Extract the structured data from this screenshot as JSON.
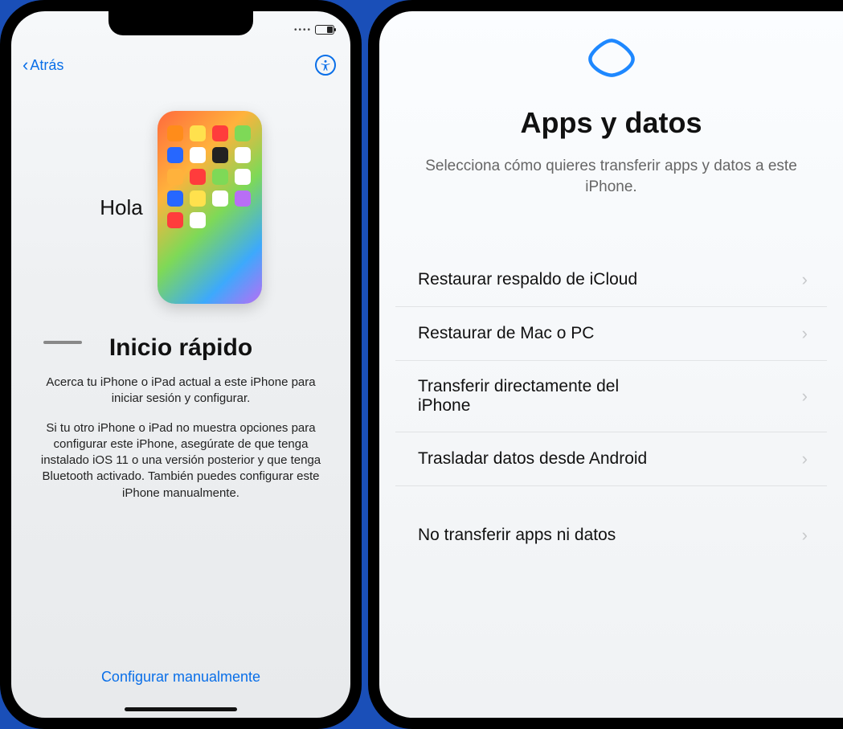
{
  "left": {
    "nav": {
      "back_label": "Atrás"
    },
    "hero": {
      "greeting": "Hola"
    },
    "panel": {
      "title": "Inicio rápido",
      "p1": "Acerca tu iPhone o iPad actual a este iPhone para iniciar sesión y configurar.",
      "p2": "Si tu otro iPhone o iPad no muestra opciones para configurar este iPhone, asegúrate de que tenga instalado iOS 11 o una versión posterior y que tenga Bluetooth activado. También puedes configurar este iPhone manualmente.",
      "manual_button": "Configurar manualmente"
    },
    "hero_icon_colors": [
      "#ff8c1a",
      "#ffe14d",
      "#ff3c3c",
      "#7ed957",
      "#2667ff",
      "#fff",
      "#222",
      "#fff",
      "#ffb23c",
      "#ff3c3c",
      "#7ed957",
      "#fff",
      "#2667ff",
      "#ffe14d",
      "#fff",
      "#b86ef5",
      "#ff3c3c",
      "#fff"
    ]
  },
  "right": {
    "title": "Apps y datos",
    "subtitle": "Selecciona cómo quieres transferir apps y datos a este iPhone.",
    "options": [
      {
        "label": "Restaurar respaldo de iCloud"
      },
      {
        "label": "Restaurar de Mac o PC"
      },
      {
        "label": "Transferir directamente del iPhone"
      },
      {
        "label": "Trasladar datos desde Android"
      },
      {
        "label": "No transferir apps ni datos"
      }
    ]
  }
}
